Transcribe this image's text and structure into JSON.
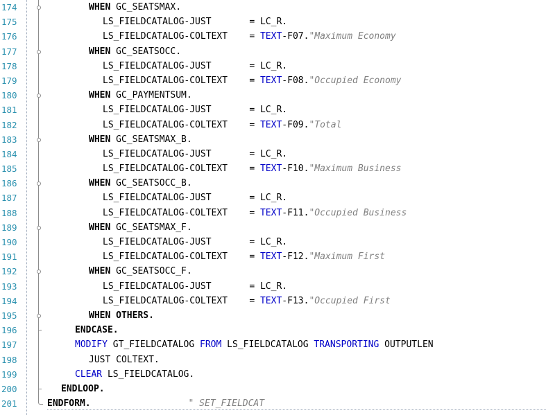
{
  "editor": {
    "lines": [
      {
        "num": "174",
        "indent": 128,
        "fold": "mid-dot",
        "parts": [
          {
            "t": "WHEN",
            "c": "kw"
          },
          {
            "t": " GC_SEATSMAX.",
            "c": ""
          }
        ]
      },
      {
        "num": "175",
        "indent": 148,
        "fold": "mid",
        "parts": [
          {
            "t": "LS_FIELDCATALOG-JUST       = LC_R.",
            "c": ""
          }
        ]
      },
      {
        "num": "176",
        "indent": 148,
        "fold": "mid",
        "parts": [
          {
            "t": "LS_FIELDCATALOG-COLTEXT    = ",
            "c": ""
          },
          {
            "t": "TEXT",
            "c": "txt"
          },
          {
            "t": "-F07.",
            "c": ""
          },
          {
            "t": "\"Maximum Economy",
            "c": "str"
          }
        ]
      },
      {
        "num": "177",
        "indent": 128,
        "fold": "mid-dot",
        "parts": [
          {
            "t": "WHEN",
            "c": "kw"
          },
          {
            "t": " GC_SEATSOCC.",
            "c": ""
          }
        ]
      },
      {
        "num": "178",
        "indent": 148,
        "fold": "mid",
        "parts": [
          {
            "t": "LS_FIELDCATALOG-JUST       = LC_R.",
            "c": ""
          }
        ]
      },
      {
        "num": "179",
        "indent": 148,
        "fold": "mid",
        "parts": [
          {
            "t": "LS_FIELDCATALOG-COLTEXT    = ",
            "c": ""
          },
          {
            "t": "TEXT",
            "c": "txt"
          },
          {
            "t": "-F08.",
            "c": ""
          },
          {
            "t": "\"Occupied Economy",
            "c": "str"
          }
        ]
      },
      {
        "num": "180",
        "indent": 128,
        "fold": "mid-dot",
        "parts": [
          {
            "t": "WHEN",
            "c": "kw"
          },
          {
            "t": " GC_PAYMENTSUM.",
            "c": ""
          }
        ]
      },
      {
        "num": "181",
        "indent": 148,
        "fold": "mid",
        "parts": [
          {
            "t": "LS_FIELDCATALOG-JUST       = LC_R.",
            "c": ""
          }
        ]
      },
      {
        "num": "182",
        "indent": 148,
        "fold": "mid",
        "parts": [
          {
            "t": "LS_FIELDCATALOG-COLTEXT    = ",
            "c": ""
          },
          {
            "t": "TEXT",
            "c": "txt"
          },
          {
            "t": "-F09.",
            "c": ""
          },
          {
            "t": "\"Total",
            "c": "str"
          }
        ]
      },
      {
        "num": "183",
        "indent": 128,
        "fold": "mid-dot",
        "parts": [
          {
            "t": "WHEN",
            "c": "kw"
          },
          {
            "t": " GC_SEATSMAX_B.",
            "c": ""
          }
        ]
      },
      {
        "num": "184",
        "indent": 148,
        "fold": "mid",
        "parts": [
          {
            "t": "LS_FIELDCATALOG-JUST       = LC_R.",
            "c": ""
          }
        ]
      },
      {
        "num": "185",
        "indent": 148,
        "fold": "mid",
        "parts": [
          {
            "t": "LS_FIELDCATALOG-COLTEXT    = ",
            "c": ""
          },
          {
            "t": "TEXT",
            "c": "txt"
          },
          {
            "t": "-F10.",
            "c": ""
          },
          {
            "t": "\"Maximum Business",
            "c": "str"
          }
        ]
      },
      {
        "num": "186",
        "indent": 128,
        "fold": "mid-dot",
        "parts": [
          {
            "t": "WHEN",
            "c": "kw"
          },
          {
            "t": " GC_SEATSOCC_B.",
            "c": ""
          }
        ]
      },
      {
        "num": "187",
        "indent": 148,
        "fold": "mid",
        "parts": [
          {
            "t": "LS_FIELDCATALOG-JUST       = LC_R.",
            "c": ""
          }
        ]
      },
      {
        "num": "188",
        "indent": 148,
        "fold": "mid",
        "parts": [
          {
            "t": "LS_FIELDCATALOG-COLTEXT    = ",
            "c": ""
          },
          {
            "t": "TEXT",
            "c": "txt"
          },
          {
            "t": "-F11.",
            "c": ""
          },
          {
            "t": "\"Occupied Business",
            "c": "str"
          }
        ]
      },
      {
        "num": "189",
        "indent": 128,
        "fold": "mid-dot",
        "parts": [
          {
            "t": "WHEN",
            "c": "kw"
          },
          {
            "t": " GC_SEATSMAX_F.",
            "c": ""
          }
        ]
      },
      {
        "num": "190",
        "indent": 148,
        "fold": "mid",
        "parts": [
          {
            "t": "LS_FIELDCATALOG-JUST       = LC_R.",
            "c": ""
          }
        ]
      },
      {
        "num": "191",
        "indent": 148,
        "fold": "mid",
        "parts": [
          {
            "t": "LS_FIELDCATALOG-COLTEXT    = ",
            "c": ""
          },
          {
            "t": "TEXT",
            "c": "txt"
          },
          {
            "t": "-F12.",
            "c": ""
          },
          {
            "t": "\"Maximum First",
            "c": "str"
          }
        ]
      },
      {
        "num": "192",
        "indent": 128,
        "fold": "mid-dot",
        "parts": [
          {
            "t": "WHEN",
            "c": "kw"
          },
          {
            "t": " GC_SEATSOCC_F.",
            "c": ""
          }
        ]
      },
      {
        "num": "193",
        "indent": 148,
        "fold": "mid",
        "parts": [
          {
            "t": "LS_FIELDCATALOG-JUST       = LC_R.",
            "c": ""
          }
        ]
      },
      {
        "num": "194",
        "indent": 148,
        "fold": "mid",
        "parts": [
          {
            "t": "LS_FIELDCATALOG-COLTEXT    = ",
            "c": ""
          },
          {
            "t": "TEXT",
            "c": "txt"
          },
          {
            "t": "-F13.",
            "c": ""
          },
          {
            "t": "\"Occupied First",
            "c": "str"
          }
        ]
      },
      {
        "num": "195",
        "indent": 128,
        "fold": "mid-dot-end",
        "parts": [
          {
            "t": "WHEN OTHERS.",
            "c": "kw"
          }
        ]
      },
      {
        "num": "196",
        "indent": 108,
        "fold": "inner-end",
        "parts": [
          {
            "t": "ENDCASE.",
            "c": "kw"
          }
        ]
      },
      {
        "num": "197",
        "indent": 108,
        "fold": "outer",
        "parts": [
          {
            "t": "MODIFY",
            "c": "kwb"
          },
          {
            "t": " GT_FIELDCATALOG ",
            "c": ""
          },
          {
            "t": "FROM",
            "c": "kwb"
          },
          {
            "t": " LS_FIELDCATALOG ",
            "c": ""
          },
          {
            "t": "TRANSPORTING",
            "c": "kwb"
          },
          {
            "t": " OUTPUTLEN",
            "c": ""
          }
        ]
      },
      {
        "num": "198",
        "indent": 128,
        "fold": "outer",
        "parts": [
          {
            "t": "JUST COLTEXT.",
            "c": ""
          }
        ]
      },
      {
        "num": "199",
        "indent": 108,
        "fold": "outer",
        "parts": [
          {
            "t": "CLEAR",
            "c": "kwb"
          },
          {
            "t": " LS_FIELDCATALOG.",
            "c": ""
          }
        ]
      },
      {
        "num": "200",
        "indent": 88,
        "fold": "outer-end",
        "parts": [
          {
            "t": "ENDLOOP.",
            "c": "kw"
          }
        ]
      },
      {
        "num": "201",
        "indent": 68,
        "fold": "form-end",
        "parts": [
          {
            "t": "ENDFORM.",
            "c": "kw"
          },
          {
            "t": "                  ",
            "c": ""
          },
          {
            "t": "\" SET_FIELDCAT",
            "c": "str"
          }
        ]
      }
    ]
  }
}
